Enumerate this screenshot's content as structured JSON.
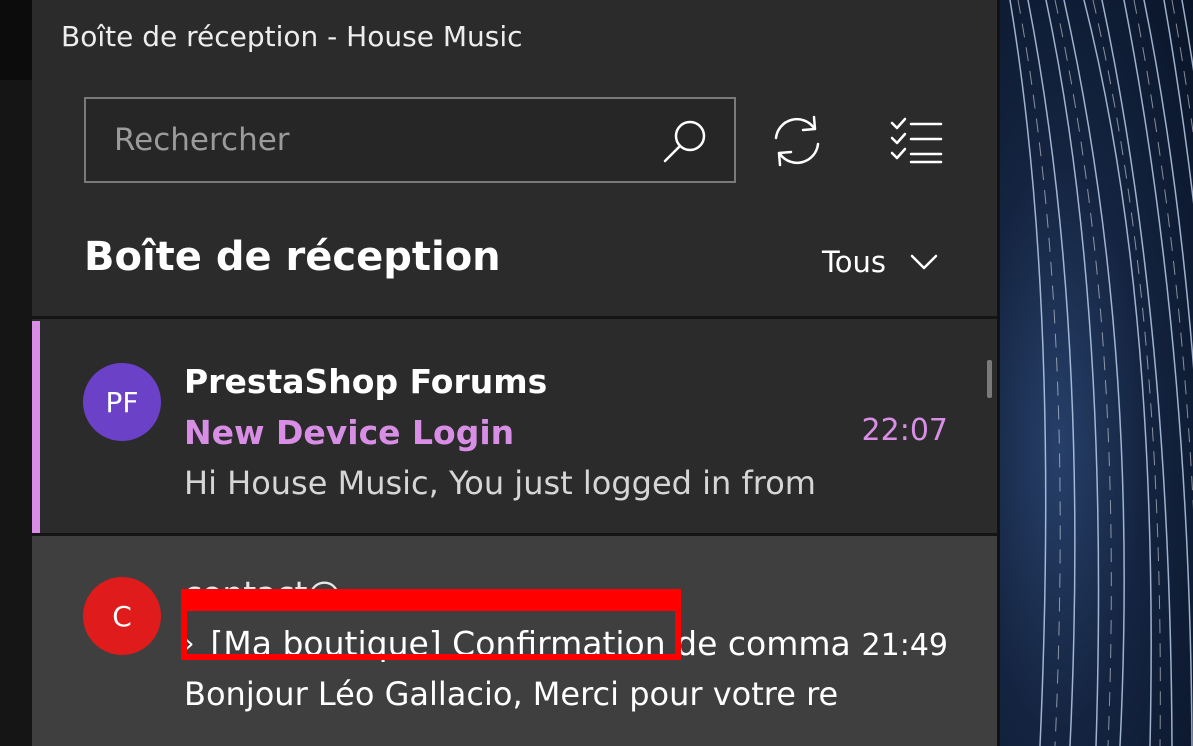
{
  "window": {
    "title": "Boîte de réception - House Music"
  },
  "search": {
    "placeholder": "Rechercher",
    "icon": "search-icon"
  },
  "toolbar": {
    "sync_icon": "sync-icon",
    "select_icon": "checklist-icon"
  },
  "folder": {
    "title": "Boîte de réception",
    "filter_label": "Tous"
  },
  "messages": [
    {
      "avatar": "PF",
      "avatar_color": "#6b42c7",
      "sender": "PrestaShop Forums",
      "subject": "New Device Login",
      "time": "22:07",
      "preview": "Hi House Music, You just logged in from",
      "unread": true,
      "accent": "#d98ee6"
    },
    {
      "avatar": "C",
      "avatar_color": "#e01b1b",
      "sender": "contact@...",
      "subject": "[Ma boutique] Confirmation de commande",
      "time": "21:49",
      "preview": "Bonjour Léo Gallacio, Merci pour votre re",
      "unread": false
    }
  ],
  "annotation": {
    "color": "#ff0000"
  }
}
